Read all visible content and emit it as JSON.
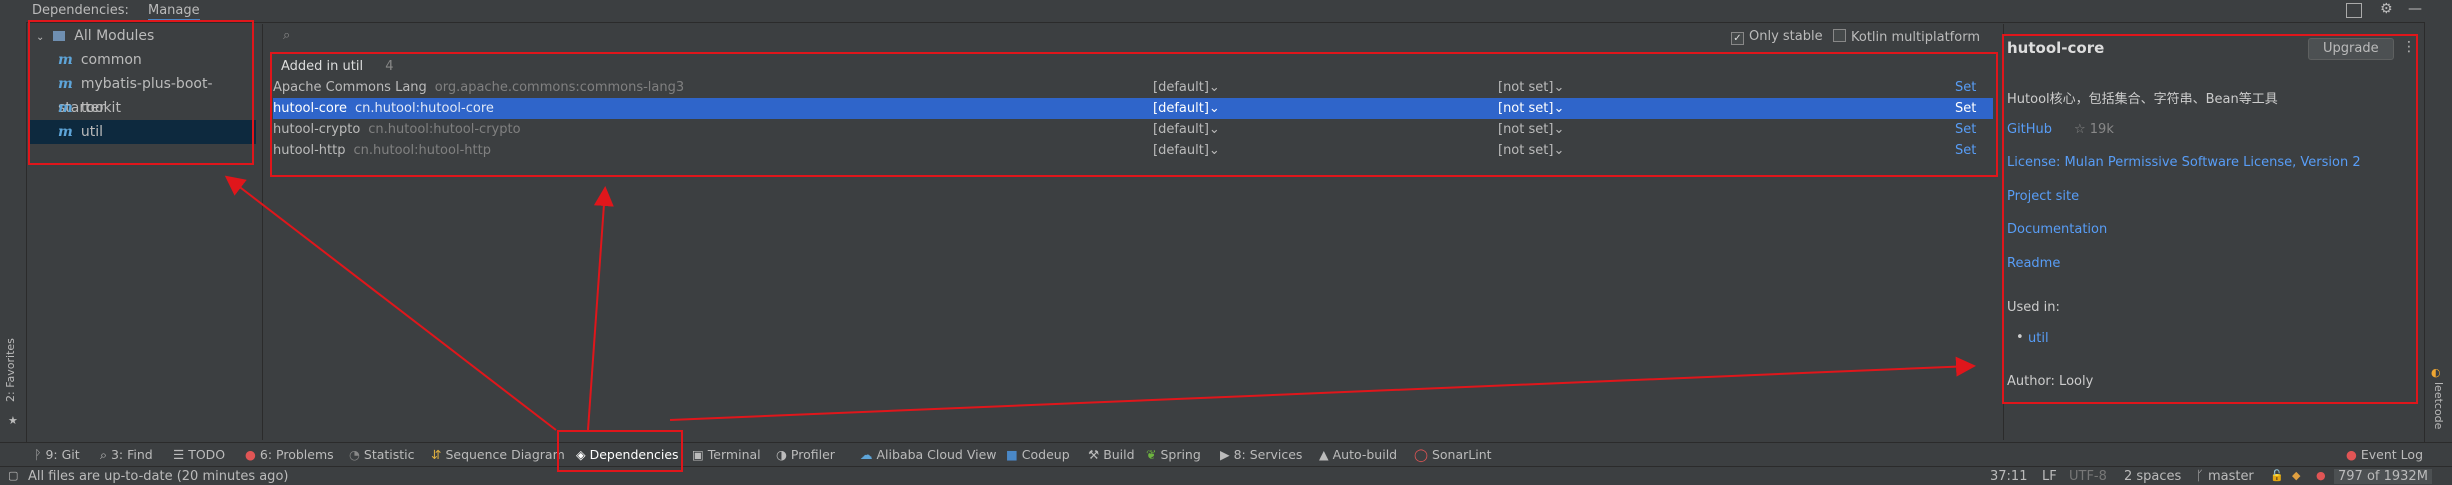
{
  "header": {
    "tab_dependencies": "Dependencies:",
    "tab_manage": "Manage"
  },
  "modules": {
    "root": "All Modules",
    "items": [
      {
        "label": "common"
      },
      {
        "label": "mybatis-plus-boot-starter"
      },
      {
        "label": "tookit"
      },
      {
        "label": "util"
      }
    ]
  },
  "search": {
    "placeholder": ""
  },
  "filters": {
    "only_stable": "Only stable",
    "kotlin_mp": "Kotlin multiplatform"
  },
  "deps": {
    "group_title": "Added in util",
    "group_count": "4",
    "rows": [
      {
        "name": "Apache Commons Lang",
        "coord": "org.apache.commons:commons-lang3",
        "scope": "[default]",
        "version": "[not set]",
        "action": "Set"
      },
      {
        "name": "hutool-core",
        "coord": "cn.hutool:hutool-core",
        "scope": "[default]",
        "version": "[not set]",
        "action": "Set"
      },
      {
        "name": "hutool-crypto",
        "coord": "cn.hutool:hutool-crypto",
        "scope": "[default]",
        "version": "[not set]",
        "action": "Set"
      },
      {
        "name": "hutool-http",
        "coord": "cn.hutool:hutool-http",
        "scope": "[default]",
        "version": "[not set]",
        "action": "Set"
      }
    ]
  },
  "detail": {
    "title": "hutool-core",
    "upgrade": "Upgrade",
    "description": "Hutool核心，包括集合、字符串、Bean等工具",
    "github": "GitHub",
    "stars": "☆ 19k",
    "license": "License: Mulan Permissive Software License, Version 2",
    "project_site": "Project site",
    "documentation": "Documentation",
    "readme": "Readme",
    "used_in_label": "Used in:",
    "used_in_item": "util",
    "author": "Author: Looly"
  },
  "side": {
    "favorites": "2: Favorites",
    "leetcode": "leetcode"
  },
  "toolbar": [
    {
      "label": "9: Git",
      "icon": "git-icon"
    },
    {
      "label": "3: Find",
      "icon": "search-icon"
    },
    {
      "label": "TODO",
      "icon": "list-icon"
    },
    {
      "label": "6: Problems",
      "icon": "error-icon"
    },
    {
      "label": "Statistic",
      "icon": "statistic-icon"
    },
    {
      "label": "Sequence Diagram",
      "icon": "sequence-icon"
    },
    {
      "label": "Dependencies",
      "icon": "dependencies-icon"
    },
    {
      "label": "Terminal",
      "icon": "terminal-icon"
    },
    {
      "label": "Profiler",
      "icon": "profiler-icon"
    },
    {
      "label": "Alibaba Cloud View",
      "icon": "cloud-icon"
    },
    {
      "label": "Codeup",
      "icon": "codeup-icon"
    },
    {
      "label": "Build",
      "icon": "hammer-icon"
    },
    {
      "label": "Spring",
      "icon": "spring-icon"
    },
    {
      "label": "8: Services",
      "icon": "services-icon"
    },
    {
      "label": "Auto-build",
      "icon": "auto-build-icon"
    },
    {
      "label": "SonarLint",
      "icon": "sonarlint-icon"
    }
  ],
  "event_log": "Event Log",
  "status": {
    "message": "All files are up-to-date (20 minutes ago)",
    "position": "37:11",
    "line_sep": "LF",
    "encoding": "UTF-8",
    "indent": "2 spaces",
    "branch": "master",
    "memory": "797 of 1932M"
  },
  "colors": {
    "accent": "#2f65ca",
    "annotation": "#e0161b",
    "link": "#589df6"
  }
}
